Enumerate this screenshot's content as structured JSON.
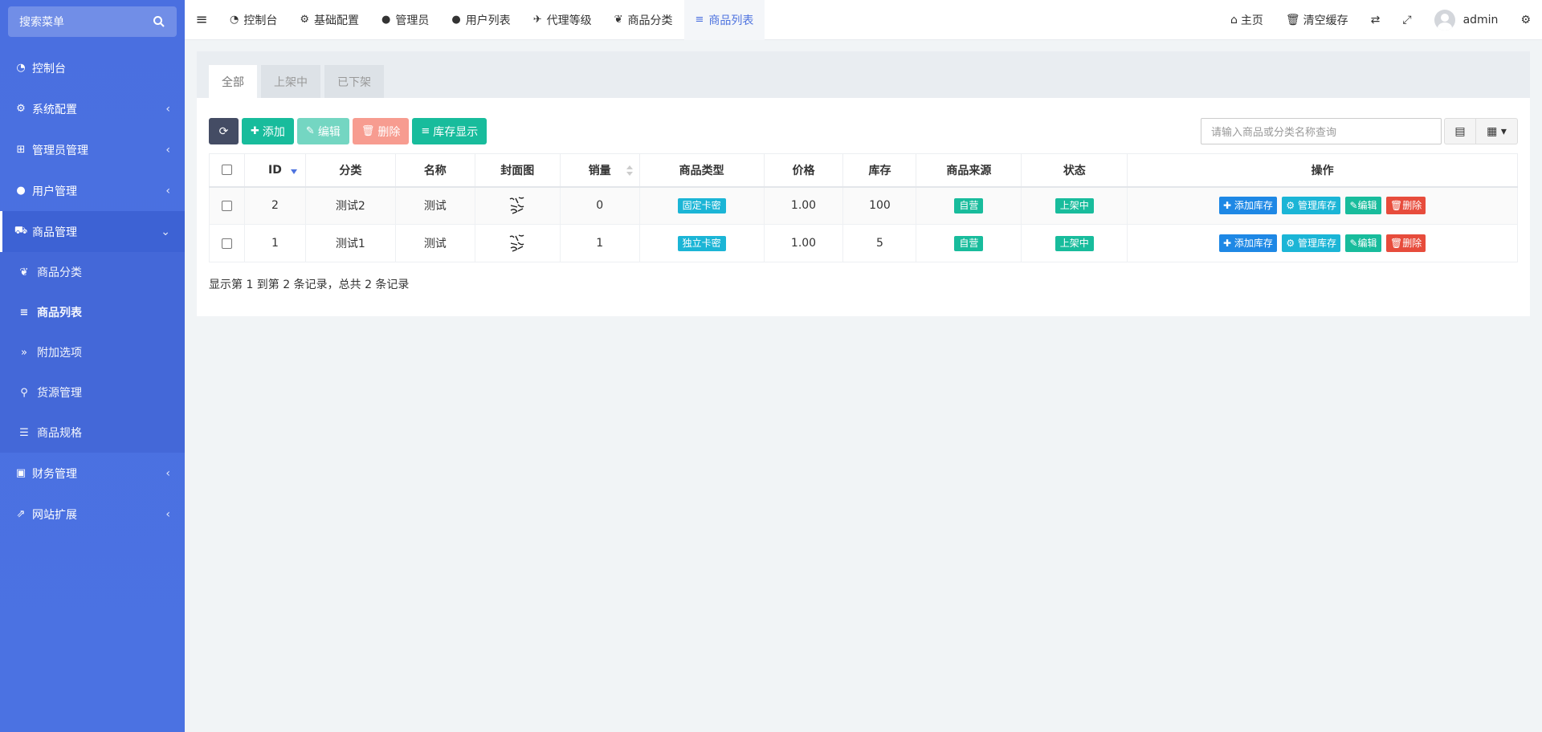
{
  "sidebar": {
    "search_placeholder": "搜索菜单",
    "menu": [
      {
        "label": "控制台",
        "icon": "dashboard-icon"
      },
      {
        "label": "系统配置",
        "icon": "cogs-icon"
      },
      {
        "label": "管理员管理",
        "icon": "windows-icon"
      },
      {
        "label": "用户管理",
        "icon": "user-icon"
      },
      {
        "label": "商品管理",
        "icon": "cart-icon"
      },
      {
        "label": "财务管理",
        "icon": "ledger-icon"
      },
      {
        "label": "网站扩展",
        "icon": "external-link-icon"
      }
    ],
    "submenu": [
      {
        "label": "商品分类",
        "icon": "leaf-icon"
      },
      {
        "label": "商品列表",
        "icon": "list-icon"
      },
      {
        "label": "附加选项",
        "icon": "double-chevron-icon"
      },
      {
        "label": "货源管理",
        "icon": "sitemap-icon"
      },
      {
        "label": "商品规格",
        "icon": "sliders-icon"
      }
    ]
  },
  "topbar": {
    "tabs": [
      {
        "label": "控制台"
      },
      {
        "label": "基础配置"
      },
      {
        "label": "管理员"
      },
      {
        "label": "用户列表"
      },
      {
        "label": "代理等级"
      },
      {
        "label": "商品分类"
      },
      {
        "label": "商品列表"
      }
    ],
    "right": {
      "home": "主页",
      "clear_cache": "清空缓存",
      "username": "admin"
    }
  },
  "panel": {
    "tabs": [
      "全部",
      "上架中",
      "已下架"
    ],
    "toolbar": {
      "add": "添加",
      "edit": "编辑",
      "delete": "删除",
      "stock_display": "库存显示"
    },
    "search_placeholder": "请输入商品或分类名称查询",
    "table": {
      "headers": [
        "ID",
        "分类",
        "名称",
        "封面图",
        "销量",
        "商品类型",
        "价格",
        "库存",
        "商品来源",
        "状态",
        "操作"
      ],
      "rows": [
        {
          "id": "2",
          "category": "测试2",
          "name": "测试",
          "sales": "0",
          "type": "固定卡密",
          "price": "1.00",
          "stock": "100",
          "source": "自营",
          "status": "上架中"
        },
        {
          "id": "1",
          "category": "测试1",
          "name": "测试",
          "sales": "1",
          "type": "独立卡密",
          "price": "1.00",
          "stock": "5",
          "source": "自营",
          "status": "上架中"
        }
      ],
      "actions": {
        "add_stock": "添加库存",
        "manage_stock": "管理库存",
        "edit": "编辑",
        "delete": "删除"
      }
    },
    "footer": "显示第 1 到第 2 条记录，总共 2 条记录"
  }
}
